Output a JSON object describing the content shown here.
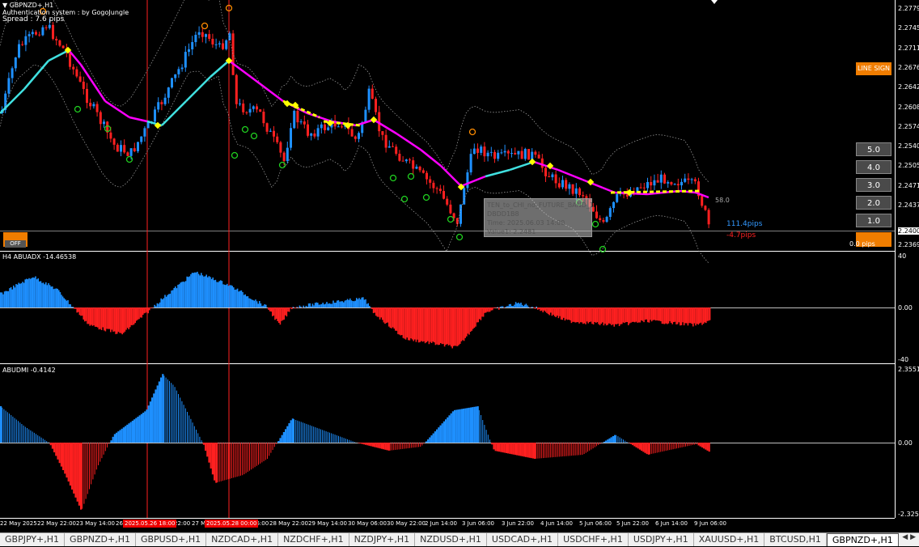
{
  "window": {
    "symbol_title": "GBPNZD+,H1",
    "auth_text": "Authentication system : by GogoJungle",
    "spread_text": "Spread : 7.6 pips"
  },
  "price_axis": {
    "ticks": [
      "2.27790",
      "2.27450",
      "2.27110",
      "2.26760",
      "2.26420",
      "2.26080",
      "2.25740",
      "2.25400",
      "2.25050",
      "2.24710",
      "2.24370",
      "2.24005",
      "2.23690"
    ],
    "current": "2.24005"
  },
  "indicator_labels": {
    "h4_abuadx": "H4 ABUADX  -14.46538",
    "h4_scale_top": "40",
    "h4_scale_mid": "0.00",
    "h4_scale_bot": "-40",
    "abudmi": "ABUDMI  -0.4142",
    "dmi_scale_top": "2.3551",
    "dmi_scale_mid": "0.00",
    "dmi_scale_bot": "-2.3251"
  },
  "buttons": {
    "line_sign": "LINE SIGN",
    "b5": "5.0",
    "b4": "4.0",
    "b3": "3.0",
    "b2": "2.0",
    "b1": "1.0",
    "off": "OFF"
  },
  "annotations": {
    "band_value": "58.0",
    "pips_up": "111.4pips",
    "pips_down": "-4.7pips",
    "pips_zero": "0.0 pips"
  },
  "tooltip": {
    "line1": "TEN_to_CHI_no_FUTURE_BAND_1",
    "line2": "DBDD1B8",
    "line3": "Time: 2025.06.03 14:00",
    "line4": "Value1: 2.2481"
  },
  "time_axis": [
    "22 May 2025",
    "22 May 22:00",
    "23 May 14:00",
    "26",
    "",
    "22:00",
    "27 M",
    "",
    "06:00",
    "28 May 22:00",
    "29 May 14:00",
    "30 May 06:00",
    "30 May 22:00",
    "2 Jun 14:00",
    "3 Jun 06:00",
    "3 Jun 22:00",
    "4 Jun 14:00",
    "5 Jun 06:00",
    "5 Jun 22:00",
    "6 Jun 14:00",
    "9 Jun 06:00"
  ],
  "time_highlight": [
    "2025.05.26 18:00",
    "2025.05.28 00:00"
  ],
  "tabs": [
    "GBPJPY+,H1",
    "GBPNZD+,H1",
    "GBPUSD+,H1",
    "NZDCAD+,H1",
    "NZDCHF+,H1",
    "NZDJPY+,H1",
    "NZDUSD+,H1",
    "USDCAD+,H1",
    "USDCHF+,H1",
    "USDJPY+,H1",
    "XAUUSD+,H1",
    "BTCUSD,H1",
    "GBPNZD+,H1"
  ],
  "colors": {
    "bull_candle": "#1e90ff",
    "bear_candle": "#ff2020",
    "ma_cyan": "#40e0e0",
    "ma_magenta": "#ff00ff",
    "signal_yellow": "#ffff00",
    "accent_orange": "#f07d00"
  }
}
